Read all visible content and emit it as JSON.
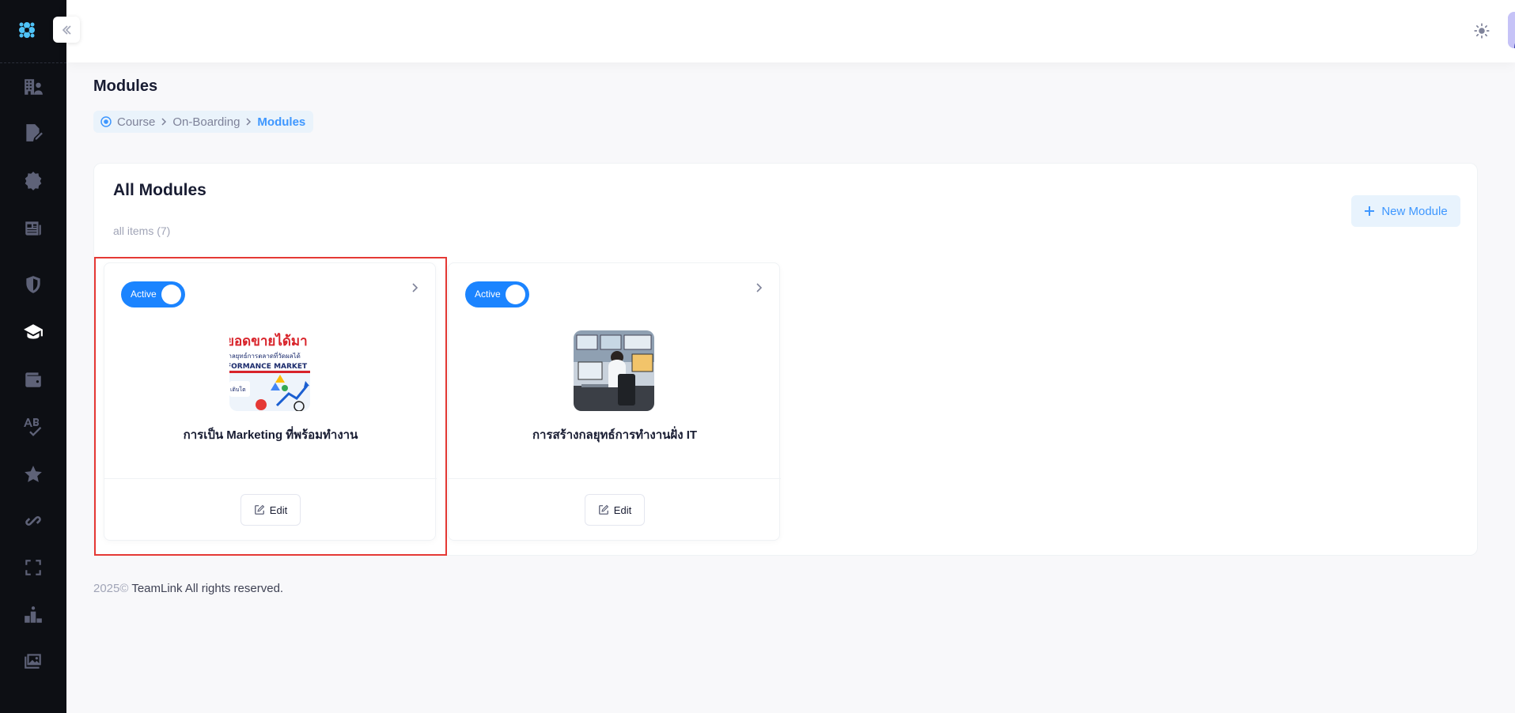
{
  "page": {
    "title": "Modules"
  },
  "breadcrumb": {
    "items": [
      "Course",
      "On-Boarding"
    ],
    "active": "Modules"
  },
  "card": {
    "title": "All Modules",
    "subtitle": "all items (7)",
    "new_button_label": "New Module"
  },
  "modules": [
    {
      "status_label": "Active",
      "name": "การเป็น Marketing ที่พร้อมทำงาน",
      "edit_label": "Edit",
      "image": {
        "banner_text": "ยอดขายได้มา",
        "line2": "กลยุทธ์การตลาดที่วัดผลได้",
        "line3": "FORMANCE MARKET",
        "tag": "เติบโต"
      },
      "selected": true
    },
    {
      "status_label": "Active",
      "name": "การสร้างกลยุทธ์การทำงานฝั่ง IT",
      "edit_label": "Edit",
      "selected": false
    }
  ],
  "footer": {
    "year": "2025©",
    "text": "TeamLink All rights reserved."
  },
  "colors": {
    "accent": "#1b84ff",
    "sidebar": "#0d0f14",
    "selection": "#e53935"
  },
  "icons": [
    "logo-icon",
    "building-users-icon",
    "certificate-edit-icon",
    "gear-badge-icon",
    "newspaper-icon",
    "shield-icon",
    "graduation-cap-icon",
    "wallet-icon",
    "spell-check-icon",
    "star-icon",
    "link-icon",
    "expand-icon",
    "ranking-icon",
    "images-icon",
    "sun-icon",
    "avatar-icon"
  ]
}
